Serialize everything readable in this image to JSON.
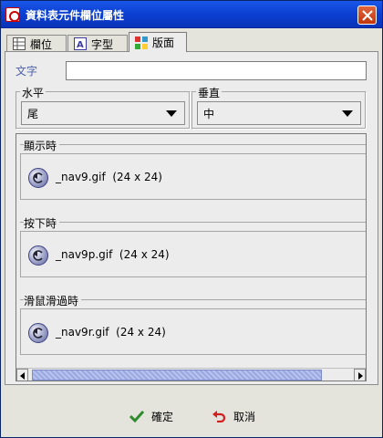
{
  "window": {
    "title": "資料表元件欄位屬性"
  },
  "tabs": [
    {
      "label": "欄位",
      "icon": "grid-icon"
    },
    {
      "label": "字型",
      "icon": "font-icon"
    },
    {
      "label": "版面",
      "icon": "layout-icon"
    }
  ],
  "active_tab": "版面",
  "text_field": {
    "label": "文字",
    "value": ""
  },
  "horizontal": {
    "title": "水平",
    "selected": "尾"
  },
  "vertical": {
    "title": "垂直",
    "selected": "中"
  },
  "states": [
    {
      "title": "顯示時",
      "file": "_nav9.gif  (24 x 24)"
    },
    {
      "title": "按下時",
      "file": "_nav9p.gif  (24 x 24)"
    },
    {
      "title": "滑鼠滑過時",
      "file": "_nav9r.gif  (24 x 24)"
    }
  ],
  "buttons": {
    "ok": "確定",
    "cancel": "取消"
  },
  "colors": {
    "titlebar": "#0b3fd1",
    "ok_check": "#2e8b2e",
    "cancel_arrow": "#d02020",
    "label_text": "#4b5fa8"
  }
}
